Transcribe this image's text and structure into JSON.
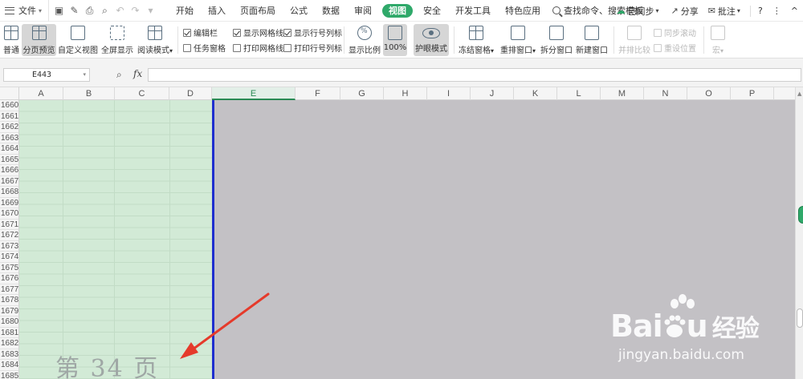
{
  "menu": {
    "file_label": "文件",
    "tabs": [
      "开始",
      "插入",
      "页面布局",
      "公式",
      "数据",
      "审阅",
      "视图",
      "安全",
      "开发工具",
      "特色应用"
    ],
    "active_tab": "视图",
    "search_label": "查找命令、搜索模板",
    "sync_label": "已同步",
    "share_label": "分享",
    "comment_label": "批注",
    "help_glyph": "?",
    "more_glyph": "⋮",
    "collapse_glyph": "^"
  },
  "ribbon": {
    "normal": "普通",
    "page_break_preview": "分页预览",
    "custom_view": "自定义视图",
    "full_screen": "全屏显示",
    "reading_mode": "阅读模式",
    "edit_bar": "编辑栏",
    "show_gridlines": "显示网格线",
    "show_row_col_headers": "显示行号列标",
    "task_pane": "任务窗格",
    "print_gridlines": "打印网格线",
    "print_row_col_headers": "打印行号列标",
    "zoom": "显示比例",
    "zoom_100": "100%",
    "eye_protection": "护眼模式",
    "freeze_panes": "冻结窗格",
    "arrange_windows": "重排窗口",
    "split_window": "拆分窗口",
    "new_window": "新建窗口",
    "side_by_side": "并排比较",
    "sync_scroll": "同步滚动",
    "reset_position": "重设位置",
    "macro": "宏"
  },
  "formula_bar": {
    "name_box": "E443",
    "fx": "fx",
    "content": ""
  },
  "columns": [
    "A",
    "B",
    "C",
    "D",
    "E",
    "F",
    "G",
    "H",
    "I",
    "J",
    "K",
    "L",
    "M",
    "N",
    "O",
    "P"
  ],
  "selected_column": "E",
  "rows": [
    "1660",
    "1661",
    "1662",
    "1663",
    "1664",
    "1665",
    "1666",
    "1667",
    "1668",
    "1669",
    "1670",
    "1671",
    "1672",
    "1673",
    "1674",
    "1675",
    "1676",
    "1677",
    "1678",
    "1679",
    "1680",
    "1681",
    "1682",
    "1683",
    "1684",
    "1685"
  ],
  "page_label": "第 34 页",
  "watermark": {
    "brand": "Bai",
    "brand_suffix": "u",
    "brand_cn": "经验",
    "url": "jingyan.baidu.com"
  },
  "colors": {
    "accent": "#2fa96a",
    "print_area": "#d2ead6",
    "non_print_area": "#c3c1c5",
    "page_break": "#1f2fcf",
    "arrow": "#e53a2b"
  }
}
